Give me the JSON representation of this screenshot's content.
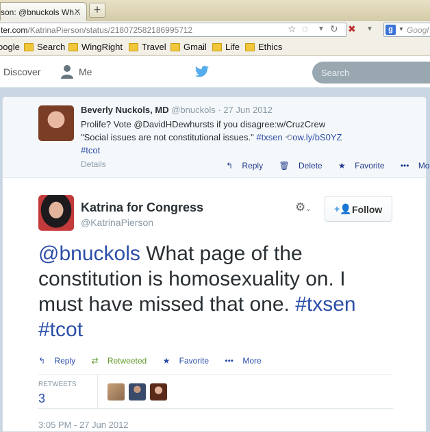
{
  "browser": {
    "tab_title": "son: @bnuckols Wh...",
    "url_host": "ter.com",
    "url_path": "/KatrinaPierson/status/218072582186995712",
    "search_placeholder": "Googl",
    "bookmarks": [
      "oogle",
      "Search",
      "WingRight",
      "Travel",
      "Gmail",
      "Life",
      "Ethics"
    ]
  },
  "twitter_nav": {
    "discover": "Discover",
    "me": "Me",
    "search_placeholder": "Search"
  },
  "parent_tweet": {
    "name": "Beverly Nuckols, MD",
    "handle": "@bnuckols",
    "date": "· 27 Jun 2012",
    "text_line1": "Prolife? Vote @DavidHDewhursts if you disagree:w/CruzCrew",
    "text_line2_a": "\"Social issues are not constitutional issues.\"",
    "hashtag_txsen": "#txsen",
    "short_link": "ow.ly/bS0YZ",
    "hashtag_tcot": "#tcot",
    "details": "Details",
    "actions": {
      "reply": "Reply",
      "delete": "Delete",
      "favorite": "Favorite",
      "more": "More"
    }
  },
  "main_tweet": {
    "name": "Katrina for Congress",
    "handle": "@KatrinaPierson",
    "follow_label": "Follow",
    "mention": "@bnuckols",
    "text": " What page of the constitution is homosexuality on. I must have missed that one. ",
    "hashtag_txsen": "#txsen",
    "hashtag_tcot": "#tcot",
    "actions": {
      "reply": "Reply",
      "retweeted": "Retweeted",
      "favorite": "Favorite",
      "more": "More"
    },
    "retweets_label": "RETWEETS",
    "retweets_count": "3",
    "timestamp": "3:05 PM - 27 Jun 2012"
  },
  "colors": {
    "link_blue": "#2b4ea8",
    "retweet_green": "#609928",
    "twitter_blue": "#55acee"
  }
}
